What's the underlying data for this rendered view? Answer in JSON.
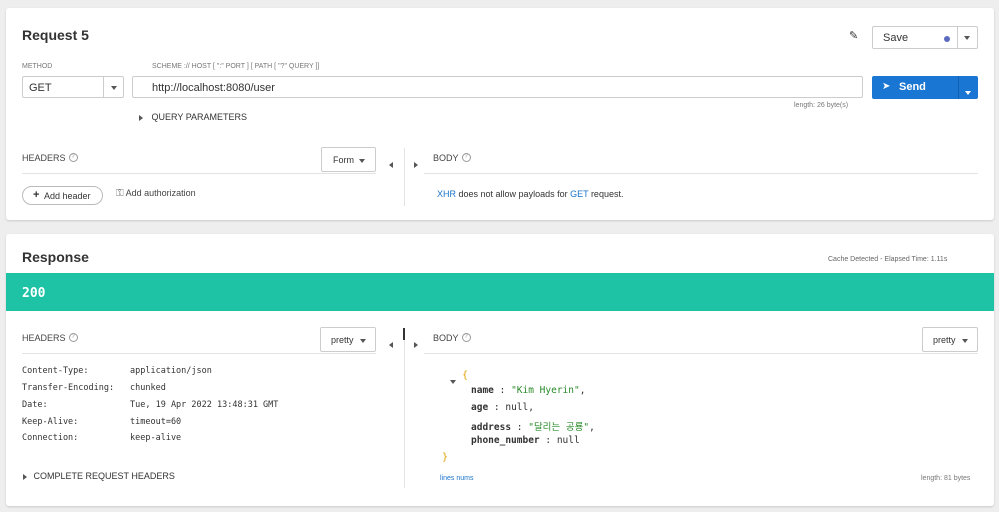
{
  "request": {
    "title": "Request 5",
    "save_label": "Save",
    "method_label": "METHOD",
    "method_value": "GET",
    "url_label": "SCHEME :// HOST [ \":\" PORT ] [ PATH [ \"?\" QUERY ]]",
    "url_value": "http://localhost:8080/user",
    "length_text": "length: 26 byte(s)",
    "send_label": "Send",
    "query_params_label": "QUERY PARAMETERS",
    "headers_label": "HEADERS",
    "headers_mode": "Form",
    "add_header_label": "Add header",
    "add_auth_label": "Add authorization",
    "body_label": "BODY",
    "body_msg": {
      "xhr": "XHR",
      "mid": " does not allow payloads for ",
      "get": "GET",
      "end": " request."
    }
  },
  "response": {
    "title": "Response",
    "cache_text": "Cache Detected - Elapsed Time: 1.11s",
    "status_code": "200",
    "headers_label": "HEADERS",
    "headers_mode": "pretty",
    "body_label": "BODY",
    "body_mode": "pretty",
    "headers": [
      {
        "key": "Content-Type:",
        "value": "application/json"
      },
      {
        "key": "Transfer-Encoding:",
        "value": "chunked"
      },
      {
        "key": "Date:",
        "value": "Tue, 19 Apr 2022 13:48:31 GMT"
      },
      {
        "key": "Keep-Alive:",
        "value": "timeout=60"
      },
      {
        "key": "Connection:",
        "value": "keep-alive"
      }
    ],
    "complete_headers_label": "COMPLETE REQUEST HEADERS",
    "json": {
      "open": "{",
      "close": "}",
      "lines": [
        {
          "key": "name",
          "sep": " : ",
          "value": "\"Kim Hyerin\"",
          "type": "string",
          "comma": ","
        },
        {
          "key": "age",
          "sep": " : ",
          "value": "null",
          "type": "null",
          "comma": ","
        },
        {
          "key": "address",
          "sep": " : ",
          "value": "\"달리는 공룡\"",
          "type": "string",
          "comma": ","
        },
        {
          "key": "phone_number",
          "sep": " : ",
          "value": "null",
          "type": "null",
          "comma": ""
        }
      ]
    },
    "lines_nums_label": "lines nums",
    "length_text": "length: 81 bytes"
  },
  "colors": {
    "accent": "#1976d2",
    "status_bar": "#1ec2a5",
    "link": "#1a73c8"
  }
}
